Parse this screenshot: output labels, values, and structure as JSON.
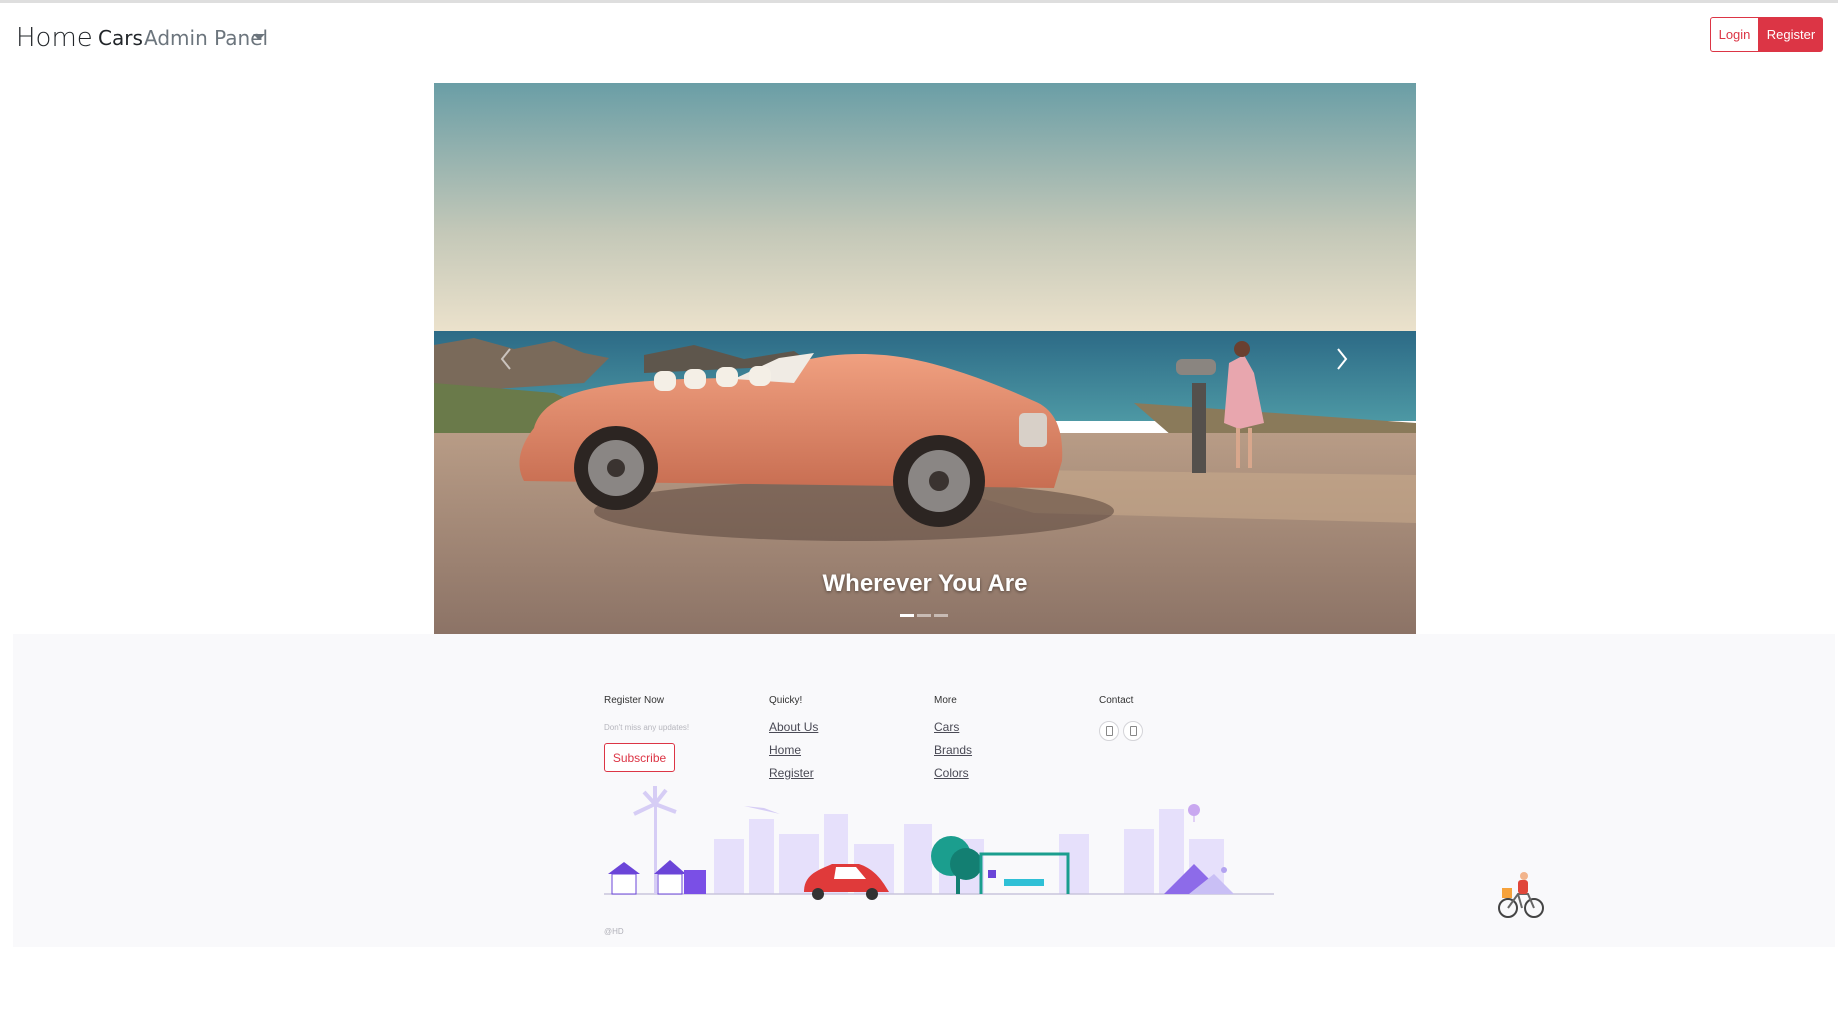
{
  "navbar": {
    "brand": "Home",
    "links": {
      "cars": "Cars",
      "admin_panel": "Admin Panel"
    },
    "buttons": {
      "login": "Login",
      "register": "Register"
    }
  },
  "carousel": {
    "caption": "Wherever You Are",
    "slide_count": 3,
    "active_slide": 1
  },
  "footer": {
    "register_now": {
      "title": "Register Now",
      "subtitle": "Don't miss any updates!",
      "button": "Subscribe"
    },
    "quick": {
      "title": "Quicky!",
      "links": [
        "About Us",
        "Home",
        "Register"
      ]
    },
    "more": {
      "title": "More",
      "links": [
        "Cars",
        "Brands",
        "Colors"
      ]
    },
    "contact": {
      "title": "Contact"
    },
    "copyright": "@HD"
  },
  "colors": {
    "danger": "#dc3545",
    "footer_bg": "#f9f9fb",
    "muted": "#6c757d",
    "car_body": "#e58b6c",
    "illustration_purple": "#c9bff5"
  }
}
